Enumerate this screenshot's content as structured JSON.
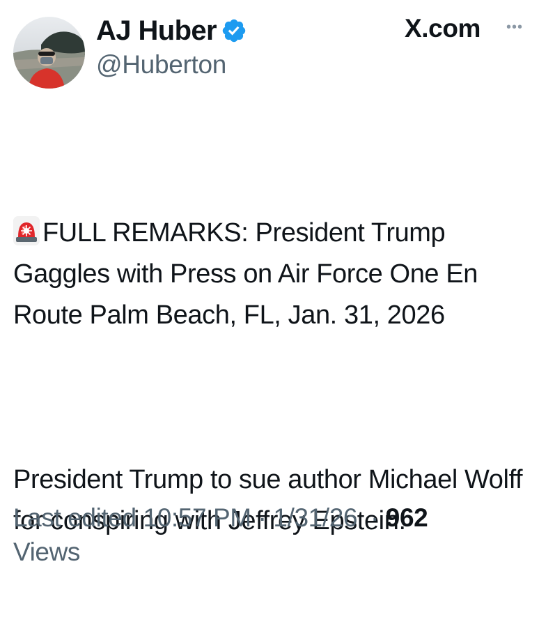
{
  "author": {
    "display_name": "AJ Huber",
    "handle": "@Huberton",
    "verified": true,
    "avatar_icon": "profile-photo"
  },
  "source": {
    "label": "X.com",
    "more_icon": "more-horizontal-icon"
  },
  "post": {
    "emoji": "rotating-light",
    "paragraphs": [
      "FULL REMARKS: President Trump Gaggles with Press on Air Force One En Route Palm Beach, FL, Jan. 31, 2026",
      "President Trump to sue author Michael Wolff for conspiring with Jeffrey Epstein:"
    ]
  },
  "meta": {
    "edited_label": "Last edited",
    "time": "10:57 PM",
    "separator": "·",
    "date": "1/31/26",
    "views_count": "962",
    "views_label": "Views"
  },
  "colors": {
    "text_primary": "#0f1419",
    "text_secondary": "#536471",
    "verified_blue": "#1d9bf0",
    "siren_red": "#e0262a"
  }
}
